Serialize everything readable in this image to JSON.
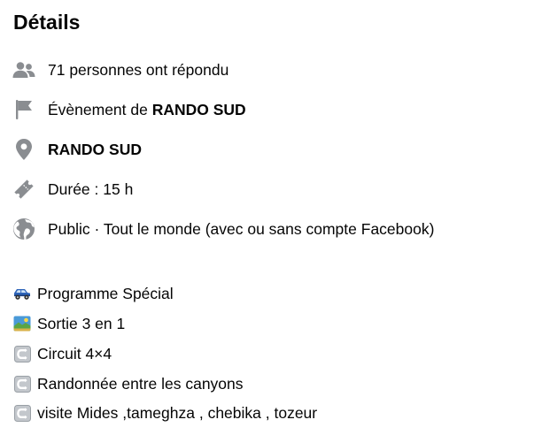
{
  "details": {
    "heading": "Détails",
    "responses": "71 personnes ont répondu",
    "event_by_prefix": "Évènement de ",
    "event_by_name": "RANDO SUD",
    "location": "RANDO SUD",
    "duration": "Durée : 15 h",
    "privacy": "Public · Tout le monde (avec ou sans compte Facebook)"
  },
  "icons": {
    "responses": "people-icon",
    "event_by": "flag-icon",
    "location": "location-pin-icon",
    "duration": "ticket-icon",
    "privacy": "globe-icon",
    "line1": "suv-car-emoji",
    "line2": "landscape-emoji",
    "line3": "arrow-curving-left-emoji",
    "line4": "arrow-curving-left-emoji",
    "line5": "arrow-curving-left-emoji"
  },
  "description": {
    "lines": [
      "Programme Spécial",
      "Sortie 3 en 1",
      "Circuit 4×4",
      "Randonnée entre les canyons",
      "visite Mides ,tameghza , chebika , tozeur"
    ]
  },
  "colors": {
    "icon_gray": "#8a8d91",
    "text": "#050505"
  }
}
